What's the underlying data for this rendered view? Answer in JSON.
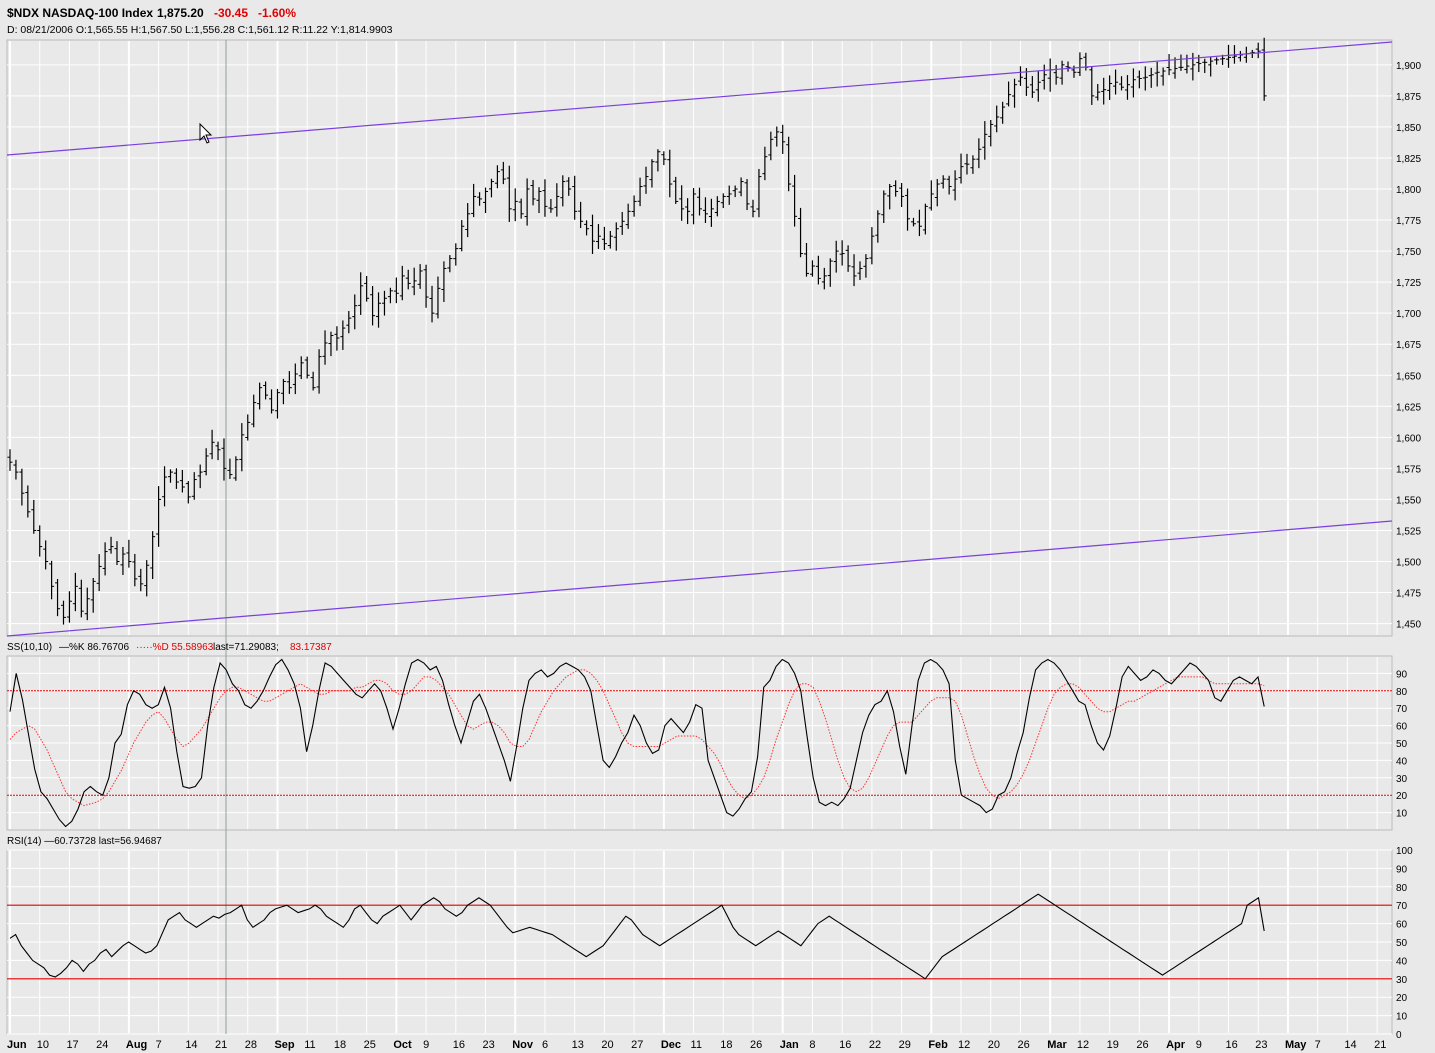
{
  "header": {
    "symbol_title": "$NDX NASDAQ-100 Index",
    "last": "1,875.20",
    "change": "-30.45",
    "change_pct": "-1.60%",
    "ohlc_line": "D: 08/21/2006 O:1,565.55 H:1,567.50 L:1,556.28 C:1,561.12 R:11.22 Y:1,814.9903"
  },
  "colors": {
    "background": "#e9e9e9",
    "grid": "#ffffff",
    "price_bars": "#000000",
    "channel": "#7b3fe0",
    "stoch_d": "#ff3030",
    "ref_line": "#e00000",
    "cursor_line": "#8fa0a0"
  },
  "legends": {
    "stoch_prefix": "SS(10,10)",
    "stoch_k": "—%K 86.76706",
    "stoch_d": "·····%D 55.58963",
    "stoch_last_a": "last=71.29083;",
    "stoch_last_b": "83.17387",
    "rsi": "RSI(14) —60.73728 last=56.94687"
  },
  "chart_data": [
    {
      "type": "ohlc",
      "name": "price",
      "ylim": [
        1440,
        1920
      ],
      "y_ticks": [
        "1,450",
        "1,475",
        "1,500",
        "1,525",
        "1,550",
        "1,575",
        "1,600",
        "1,625",
        "1,650",
        "1,675",
        "1,700",
        "1,725",
        "1,750",
        "1,775",
        "1,800",
        "1,825",
        "1,850",
        "1,875",
        "1,900"
      ],
      "x_ticks": [
        {
          "label": "Jun",
          "bold": true
        },
        {
          "label": "10"
        },
        {
          "label": "17"
        },
        {
          "label": "24"
        },
        {
          "label": "Aug",
          "bold": true
        },
        {
          "label": "7"
        },
        {
          "label": "14"
        },
        {
          "label": "21"
        },
        {
          "label": "28"
        },
        {
          "label": "Sep",
          "bold": true
        },
        {
          "label": "11"
        },
        {
          "label": "18"
        },
        {
          "label": "25"
        },
        {
          "label": "Oct",
          "bold": true
        },
        {
          "label": "9"
        },
        {
          "label": "16"
        },
        {
          "label": "23"
        },
        {
          "label": "Nov",
          "bold": true
        },
        {
          "label": "6"
        },
        {
          "label": "13"
        },
        {
          "label": "20"
        },
        {
          "label": "27"
        },
        {
          "label": "Dec",
          "bold": true
        },
        {
          "label": "11"
        },
        {
          "label": "18"
        },
        {
          "label": "26"
        },
        {
          "label": "Jan",
          "bold": true
        },
        {
          "label": "8"
        },
        {
          "label": "16"
        },
        {
          "label": "22"
        },
        {
          "label": "29"
        },
        {
          "label": "Feb",
          "bold": true
        },
        {
          "label": "12"
        },
        {
          "label": "20"
        },
        {
          "label": "26"
        },
        {
          "label": "Mar",
          "bold": true
        },
        {
          "label": "12"
        },
        {
          "label": "19"
        },
        {
          "label": "26"
        },
        {
          "label": "Apr",
          "bold": true
        },
        {
          "label": "9"
        },
        {
          "label": "16"
        },
        {
          "label": "23"
        },
        {
          "label": "May",
          "bold": true
        },
        {
          "label": "7"
        },
        {
          "label": "14"
        },
        {
          "label": "21"
        }
      ],
      "x_tick_index": [
        0,
        5,
        10,
        15,
        20,
        25,
        30,
        35,
        40,
        45,
        50,
        55,
        60,
        65,
        70,
        75,
        80,
        85,
        90,
        95,
        100,
        105,
        110,
        115,
        120,
        125,
        130,
        135,
        140,
        145,
        150,
        155,
        160,
        165,
        170,
        175,
        180,
        185,
        190,
        195,
        200,
        205,
        210,
        215,
        220,
        225,
        230
      ],
      "bar_count": 226,
      "closes": [
        1580,
        1572,
        1555,
        1540,
        1525,
        1512,
        1500,
        1480,
        1462,
        1455,
        1468,
        1480,
        1460,
        1470,
        1484,
        1496,
        1508,
        1512,
        1500,
        1506,
        1500,
        1486,
        1482,
        1497,
        1520,
        1550,
        1568,
        1572,
        1564,
        1560,
        1552,
        1566,
        1572,
        1585,
        1596,
        1590,
        1575,
        1570,
        1582,
        1602,
        1612,
        1628,
        1640,
        1634,
        1622,
        1636,
        1645,
        1640,
        1651,
        1660,
        1650,
        1640,
        1665,
        1676,
        1682,
        1680,
        1688,
        1696,
        1706,
        1722,
        1712,
        1698,
        1708,
        1712,
        1718,
        1716,
        1730,
        1724,
        1726,
        1734,
        1713,
        1700,
        1720,
        1736,
        1744,
        1752,
        1770,
        1780,
        1794,
        1792,
        1798,
        1806,
        1814,
        1808,
        1784,
        1790,
        1780,
        1800,
        1792,
        1798,
        1786,
        1784,
        1794,
        1806,
        1800,
        1782,
        1774,
        1768,
        1758,
        1762,
        1756,
        1762,
        1768,
        1774,
        1782,
        1790,
        1802,
        1810,
        1822,
        1830,
        1824,
        1804,
        1790,
        1784,
        1782,
        1796,
        1784,
        1780,
        1784,
        1790,
        1794,
        1796,
        1800,
        1806,
        1788,
        1782,
        1810,
        1826,
        1840,
        1846,
        1838,
        1804,
        1778,
        1748,
        1732,
        1738,
        1728,
        1730,
        1742,
        1750,
        1748,
        1738,
        1730,
        1736,
        1744,
        1762,
        1780,
        1796,
        1802,
        1798,
        1794,
        1776,
        1772,
        1770,
        1786,
        1796,
        1804,
        1808,
        1802,
        1808,
        1818,
        1820,
        1824,
        1832,
        1844,
        1852,
        1858,
        1866,
        1876,
        1884,
        1890,
        1882,
        1878,
        1886,
        1892,
        1896,
        1890,
        1900,
        1898,
        1894,
        1905,
        1898,
        1875,
        1878,
        1880,
        1885,
        1886,
        1882,
        1884,
        1888,
        1889,
        1890,
        1892,
        1894,
        1895,
        1896,
        1897,
        1898,
        1899,
        1900,
        1901,
        1902,
        1903,
        1904,
        1905,
        1906,
        1907,
        1908,
        1909,
        1910,
        1911,
        1875
      ]
    },
    {
      "type": "line",
      "name": "stochastic",
      "ylim": [
        0,
        100
      ],
      "y_ticks": [
        "10",
        "20",
        "30",
        "40",
        "50",
        "60",
        "70",
        "80",
        "90"
      ],
      "ref_lines": [
        20,
        80
      ],
      "series": [
        {
          "legend_key": "stoch_k",
          "style": "solid",
          "values": [
            68,
            90,
            75,
            55,
            35,
            22,
            18,
            12,
            6,
            2,
            5,
            12,
            22,
            25,
            22,
            20,
            30,
            50,
            55,
            72,
            80,
            78,
            72,
            70,
            72,
            82,
            70,
            45,
            25,
            24,
            25,
            30,
            60,
            82,
            96,
            92,
            84,
            80,
            72,
            70,
            74,
            80,
            88,
            95,
            98,
            92,
            84,
            70,
            45,
            60,
            80,
            96,
            94,
            90,
            86,
            82,
            78,
            76,
            80,
            84,
            80,
            70,
            58,
            70,
            84,
            96,
            98,
            96,
            92,
            94,
            86,
            72,
            60,
            50,
            62,
            74,
            78,
            70,
            60,
            50,
            40,
            28,
            48,
            70,
            86,
            90,
            92,
            88,
            90,
            94,
            96,
            94,
            92,
            88,
            80,
            60,
            40,
            36,
            42,
            50,
            56,
            66,
            60,
            50,
            44,
            46,
            60,
            64,
            60,
            56,
            62,
            72,
            70,
            40,
            30,
            20,
            10,
            8,
            12,
            18,
            22,
            42,
            82,
            86,
            94,
            98,
            96,
            90,
            80,
            54,
            30,
            16,
            14,
            16,
            14,
            18,
            24,
            40,
            56,
            66,
            72,
            74,
            80,
            68,
            48,
            32,
            60,
            86,
            96,
            98,
            96,
            92,
            84,
            40,
            20,
            18,
            16,
            14,
            10,
            12,
            20,
            22,
            30,
            44,
            56,
            76,
            92,
            96,
            98,
            96,
            92,
            86,
            80,
            74,
            72,
            60,
            50,
            46,
            54,
            70,
            88,
            94,
            90,
            86,
            88,
            92,
            90,
            86,
            84,
            88,
            92,
            96,
            94,
            90,
            86,
            76,
            74,
            80,
            86,
            88,
            86,
            84,
            88,
            71
          ]
        },
        {
          "legend_key": "stoch_d",
          "style": "dotted",
          "values": [
            52,
            56,
            58,
            60,
            58,
            52,
            46,
            38,
            30,
            22,
            18,
            16,
            14,
            15,
            16,
            18,
            22,
            28,
            34,
            42,
            50,
            56,
            62,
            66,
            68,
            64,
            58,
            52,
            48,
            50,
            54,
            58,
            64,
            70,
            76,
            80,
            82,
            82,
            80,
            78,
            76,
            74,
            74,
            76,
            78,
            80,
            82,
            84,
            82,
            80,
            78,
            78,
            80,
            80,
            80,
            80,
            82,
            82,
            84,
            86,
            86,
            84,
            80,
            78,
            78,
            80,
            84,
            88,
            88,
            86,
            82,
            78,
            72,
            66,
            60,
            58,
            60,
            62,
            62,
            60,
            56,
            50,
            48,
            48,
            52,
            60,
            68,
            74,
            80,
            84,
            88,
            90,
            92,
            92,
            90,
            86,
            80,
            72,
            64,
            56,
            50,
            48,
            48,
            48,
            48,
            48,
            50,
            52,
            54,
            54,
            54,
            54,
            52,
            48,
            44,
            38,
            30,
            24,
            20,
            18,
            20,
            24,
            30,
            40,
            52,
            62,
            72,
            80,
            84,
            84,
            82,
            74,
            64,
            52,
            40,
            30,
            24,
            22,
            24,
            30,
            38,
            46,
            54,
            60,
            62,
            62,
            62,
            66,
            70,
            74,
            76,
            76,
            76,
            74,
            66,
            54,
            42,
            32,
            24,
            20,
            18,
            20,
            22,
            26,
            32,
            40,
            50,
            60,
            70,
            78,
            82,
            84,
            84,
            82,
            78,
            74,
            70,
            68,
            68,
            70,
            72,
            74,
            74,
            76,
            78,
            80,
            82,
            84,
            86,
            88,
            88,
            88,
            88,
            88,
            86,
            84,
            84,
            84,
            84,
            84,
            84,
            84,
            84,
            83
          ]
        }
      ]
    },
    {
      "type": "line",
      "name": "rsi",
      "ylim": [
        0,
        100
      ],
      "y_ticks": [
        "0",
        "10",
        "20",
        "30",
        "40",
        "50",
        "60",
        "70",
        "80",
        "90",
        "100"
      ],
      "ref_lines": [
        30,
        70
      ],
      "series": [
        {
          "legend_key": "rsi",
          "style": "solid",
          "values": [
            52,
            54,
            48,
            44,
            40,
            38,
            36,
            32,
            31,
            33,
            36,
            40,
            38,
            34,
            38,
            40,
            44,
            46,
            42,
            45,
            48,
            50,
            48,
            46,
            44,
            45,
            48,
            55,
            62,
            64,
            66,
            62,
            60,
            58,
            60,
            62,
            64,
            63,
            65,
            66,
            68,
            70,
            62,
            58,
            60,
            62,
            66,
            68,
            69,
            70,
            68,
            66,
            67,
            68,
            70,
            68,
            64,
            62,
            60,
            58,
            62,
            68,
            70,
            66,
            62,
            60,
            64,
            66,
            68,
            70,
            66,
            62,
            66,
            70,
            72,
            74,
            72,
            68,
            66,
            64,
            66,
            70,
            72,
            74,
            72,
            70,
            66,
            62,
            58,
            55,
            56,
            57,
            58,
            57,
            56,
            55,
            54,
            52,
            50,
            48,
            46,
            44,
            42,
            44,
            46,
            48,
            52,
            56,
            60,
            64,
            62,
            58,
            54,
            52,
            50,
            48,
            50,
            52,
            54,
            56,
            58,
            60,
            62,
            64,
            66,
            68,
            70,
            64,
            58,
            54,
            52,
            50,
            48,
            50,
            52,
            54,
            56,
            54,
            52,
            50,
            48,
            52,
            56,
            60,
            62,
            64,
            62,
            60,
            58,
            56,
            54,
            52,
            50,
            48,
            46,
            44,
            42,
            40,
            38,
            36,
            34,
            32,
            30,
            34,
            38,
            42,
            44,
            46,
            48,
            50,
            52,
            54,
            56,
            58,
            60,
            62,
            64,
            66,
            68,
            70,
            72,
            74,
            76,
            74,
            72,
            70,
            68,
            66,
            64,
            62,
            60,
            58,
            56,
            54,
            52,
            50,
            48,
            46,
            44,
            42,
            40,
            38,
            36,
            34,
            32,
            34,
            36,
            38,
            40,
            42,
            44,
            46,
            48,
            50,
            52,
            54,
            56,
            58,
            60,
            70,
            72,
            74,
            56
          ]
        }
      ]
    }
  ]
}
